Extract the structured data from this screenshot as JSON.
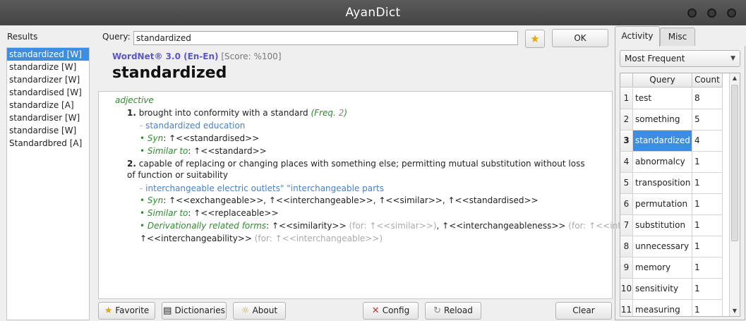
{
  "window": {
    "title": "AyanDict"
  },
  "results": {
    "label": "Results",
    "items": [
      {
        "text": "standardized [W]",
        "selected": true
      },
      {
        "text": "standardize [W]"
      },
      {
        "text": "standardizer [W]"
      },
      {
        "text": "standardised [W]"
      },
      {
        "text": "standardize [A]"
      },
      {
        "text": "standardiser [W]"
      },
      {
        "text": "standardise [W]"
      },
      {
        "text": "Standardbred [A]"
      }
    ]
  },
  "query": {
    "label": "Query:",
    "value": "standardized",
    "ok_label": "OK"
  },
  "definition": {
    "dict_name": "WordNet® 3.0 (En-En)",
    "score": "[Score: %100]",
    "headword": "standardized",
    "pos": "adjective",
    "sense1": {
      "num": "1.",
      "text": "brought into conformity with a standard",
      "freq_label": "Freq.",
      "freq_value": "2",
      "example": "standardized education",
      "syn_label": "Syn",
      "syn_value": "↑<<standardised>>",
      "similar_label": "Similar to",
      "similar_value": "↑<<standard>>"
    },
    "sense2": {
      "num": "2.",
      "text": "capable of replacing or changing places with something else; permitting mutual substitution without loss of function or suitability",
      "example": "interchangeable electric outlets\" \"interchangeable parts",
      "syn_label": "Syn",
      "syn_value": "↑<<exchangeable>>, ↑<<interchangeable>>, ↑<<similar>>, ↑<<standardised>>",
      "similar_label": "Similar to",
      "similar_value": "↑<<replaceable>>",
      "deriv_label": "Derivationally related forms",
      "deriv_1": "↑<<similarity>>",
      "deriv_1_for": "(for: ↑<<similar>>)",
      "deriv_2": "↑<<interchangeableness>>",
      "deriv_2_for": "(for: ↑<<interchangeable>>)",
      "deriv_3": "↑<<interchangeability>>",
      "deriv_3_for": "(for: ↑<<interchangeable>>)"
    }
  },
  "buttons": {
    "favorite": "Favorite",
    "dictionaries": "Dictionaries",
    "about": "About",
    "config": "Config",
    "reload": "Reload",
    "clear": "Clear"
  },
  "side": {
    "tabs": [
      "Activity",
      "Misc"
    ],
    "combo": "Most Frequent",
    "headers": {
      "query": "Query",
      "count": "Count"
    },
    "rows": [
      {
        "n": "1",
        "q": "test",
        "c": "8"
      },
      {
        "n": "2",
        "q": "something",
        "c": "5"
      },
      {
        "n": "3",
        "q": "standardized",
        "c": "4",
        "selected": true
      },
      {
        "n": "4",
        "q": "abnormalcy",
        "c": "1"
      },
      {
        "n": "5",
        "q": "transposition",
        "c": "1"
      },
      {
        "n": "6",
        "q": "permutation",
        "c": "1"
      },
      {
        "n": "7",
        "q": "substitution",
        "c": "1"
      },
      {
        "n": "8",
        "q": "unnecessary",
        "c": "1"
      },
      {
        "n": "9",
        "q": "memory",
        "c": "1"
      },
      {
        "n": "10",
        "q": "sensitivity",
        "c": "1"
      },
      {
        "n": "11",
        "q": "measuring",
        "c": "1"
      }
    ]
  }
}
